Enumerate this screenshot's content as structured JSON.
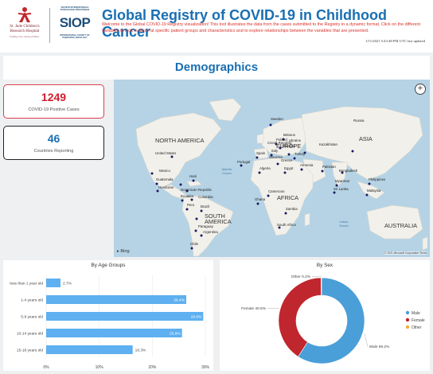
{
  "header": {
    "logo1_line1": "St. Jude Children's",
    "logo1_line2": "Research Hospital",
    "logo1_tagline": "Finding cures. Saving children.",
    "logo2_top": "SOCIÉTÉ INTERNATIONALE D'ONCOLOGIE PÉDIATRIQUE",
    "logo2_text": "SIOP",
    "logo2_bottom": "INTERNATIONAL SOCIETY OF PAEDIATRIC ONCOLOGY",
    "title": "Global Registry of COVID-19 in Childhood Cancer",
    "description": "Welcome to the Global COVID-19 Registry visualization! This tool illustrates the data from the cases submitted to the Registry in a dynamic format. Click on the different variables to look in depth at specific patient groups and characteristics and to explore relationships between the variables that are presented.",
    "last_updated": "1/11/2021 5:43:48 PM UTC last updated"
  },
  "section_title": "Demographics",
  "cards": [
    {
      "value": "1249",
      "label": "COVID-19 Positive Cases"
    },
    {
      "value": "46",
      "label": "Countries Reporting"
    }
  ],
  "map": {
    "continents": [
      "NORTH AMERICA",
      "EUROPE",
      "ASIA",
      "AFRICA",
      "SOUTH AMERICA",
      "AUSTRALIA"
    ],
    "oceans": [
      "Atlantic Ocean",
      "Indian Ocean"
    ],
    "countries": [
      "Sweden",
      "Russia",
      "Belarus",
      "Poland",
      "Czech Republic",
      "Ukraine",
      "Slovakia",
      "Spain",
      "Italy",
      "Kazakhstan",
      "Portugal",
      "Slovenia",
      "Turkey",
      "Greece",
      "Algeria",
      "Egypt",
      "Armenia",
      "Pakistan",
      "Bangladesh",
      "Philippines",
      "Myanmar",
      "Sri Lanka",
      "Malaysia",
      "Cameroon",
      "Ghana",
      "Zambia",
      "South Africa",
      "United States",
      "Mexico",
      "Haiti",
      "Guatemala",
      "Honduras",
      "Dominican Republic",
      "Ecuador",
      "Colombia",
      "Peru",
      "Brazil",
      "Paraguay",
      "Argentina",
      "Chile"
    ],
    "zoom_button": "+",
    "attribution": "Bing",
    "copyright": "© 2021 Microsoft Corporation  Terms",
    "colors": {
      "water": "#b6d3e5",
      "land": "#f2f0ea",
      "marker": "#1a1a5e"
    }
  },
  "chart_data": [
    {
      "type": "bar",
      "orientation": "horizontal",
      "title": "By Age Groups",
      "categories": [
        "less than 1 year old",
        "1-4 years old",
        "5-9 years old",
        "10-14 years old",
        "15-18 years old"
      ],
      "values": [
        2.7,
        26.4,
        29.6,
        25.6,
        16.3
      ],
      "value_labels": [
        "2.7%",
        "26.4%",
        "29.6%",
        "25.6%",
        "16.3%"
      ],
      "xticks": [
        "0%",
        "10%",
        "20%",
        "30%"
      ],
      "xlim": [
        0,
        30
      ],
      "color": "#5eb0f0"
    },
    {
      "type": "pie",
      "donut": true,
      "title": "By Sex",
      "slices": [
        {
          "name": "Male",
          "value": 59.2,
          "label": "Male 59.2%",
          "color": "#4a9fd8"
        },
        {
          "name": "Female",
          "value": 40.6,
          "label": "Female 40.6%",
          "color": "#c0262d"
        },
        {
          "name": "Other",
          "value": 0.2,
          "label": "Other 0.2%",
          "color": "#f0b03c"
        }
      ],
      "legend": [
        "Male",
        "Female",
        "Other"
      ],
      "legend_position": "right"
    }
  ]
}
